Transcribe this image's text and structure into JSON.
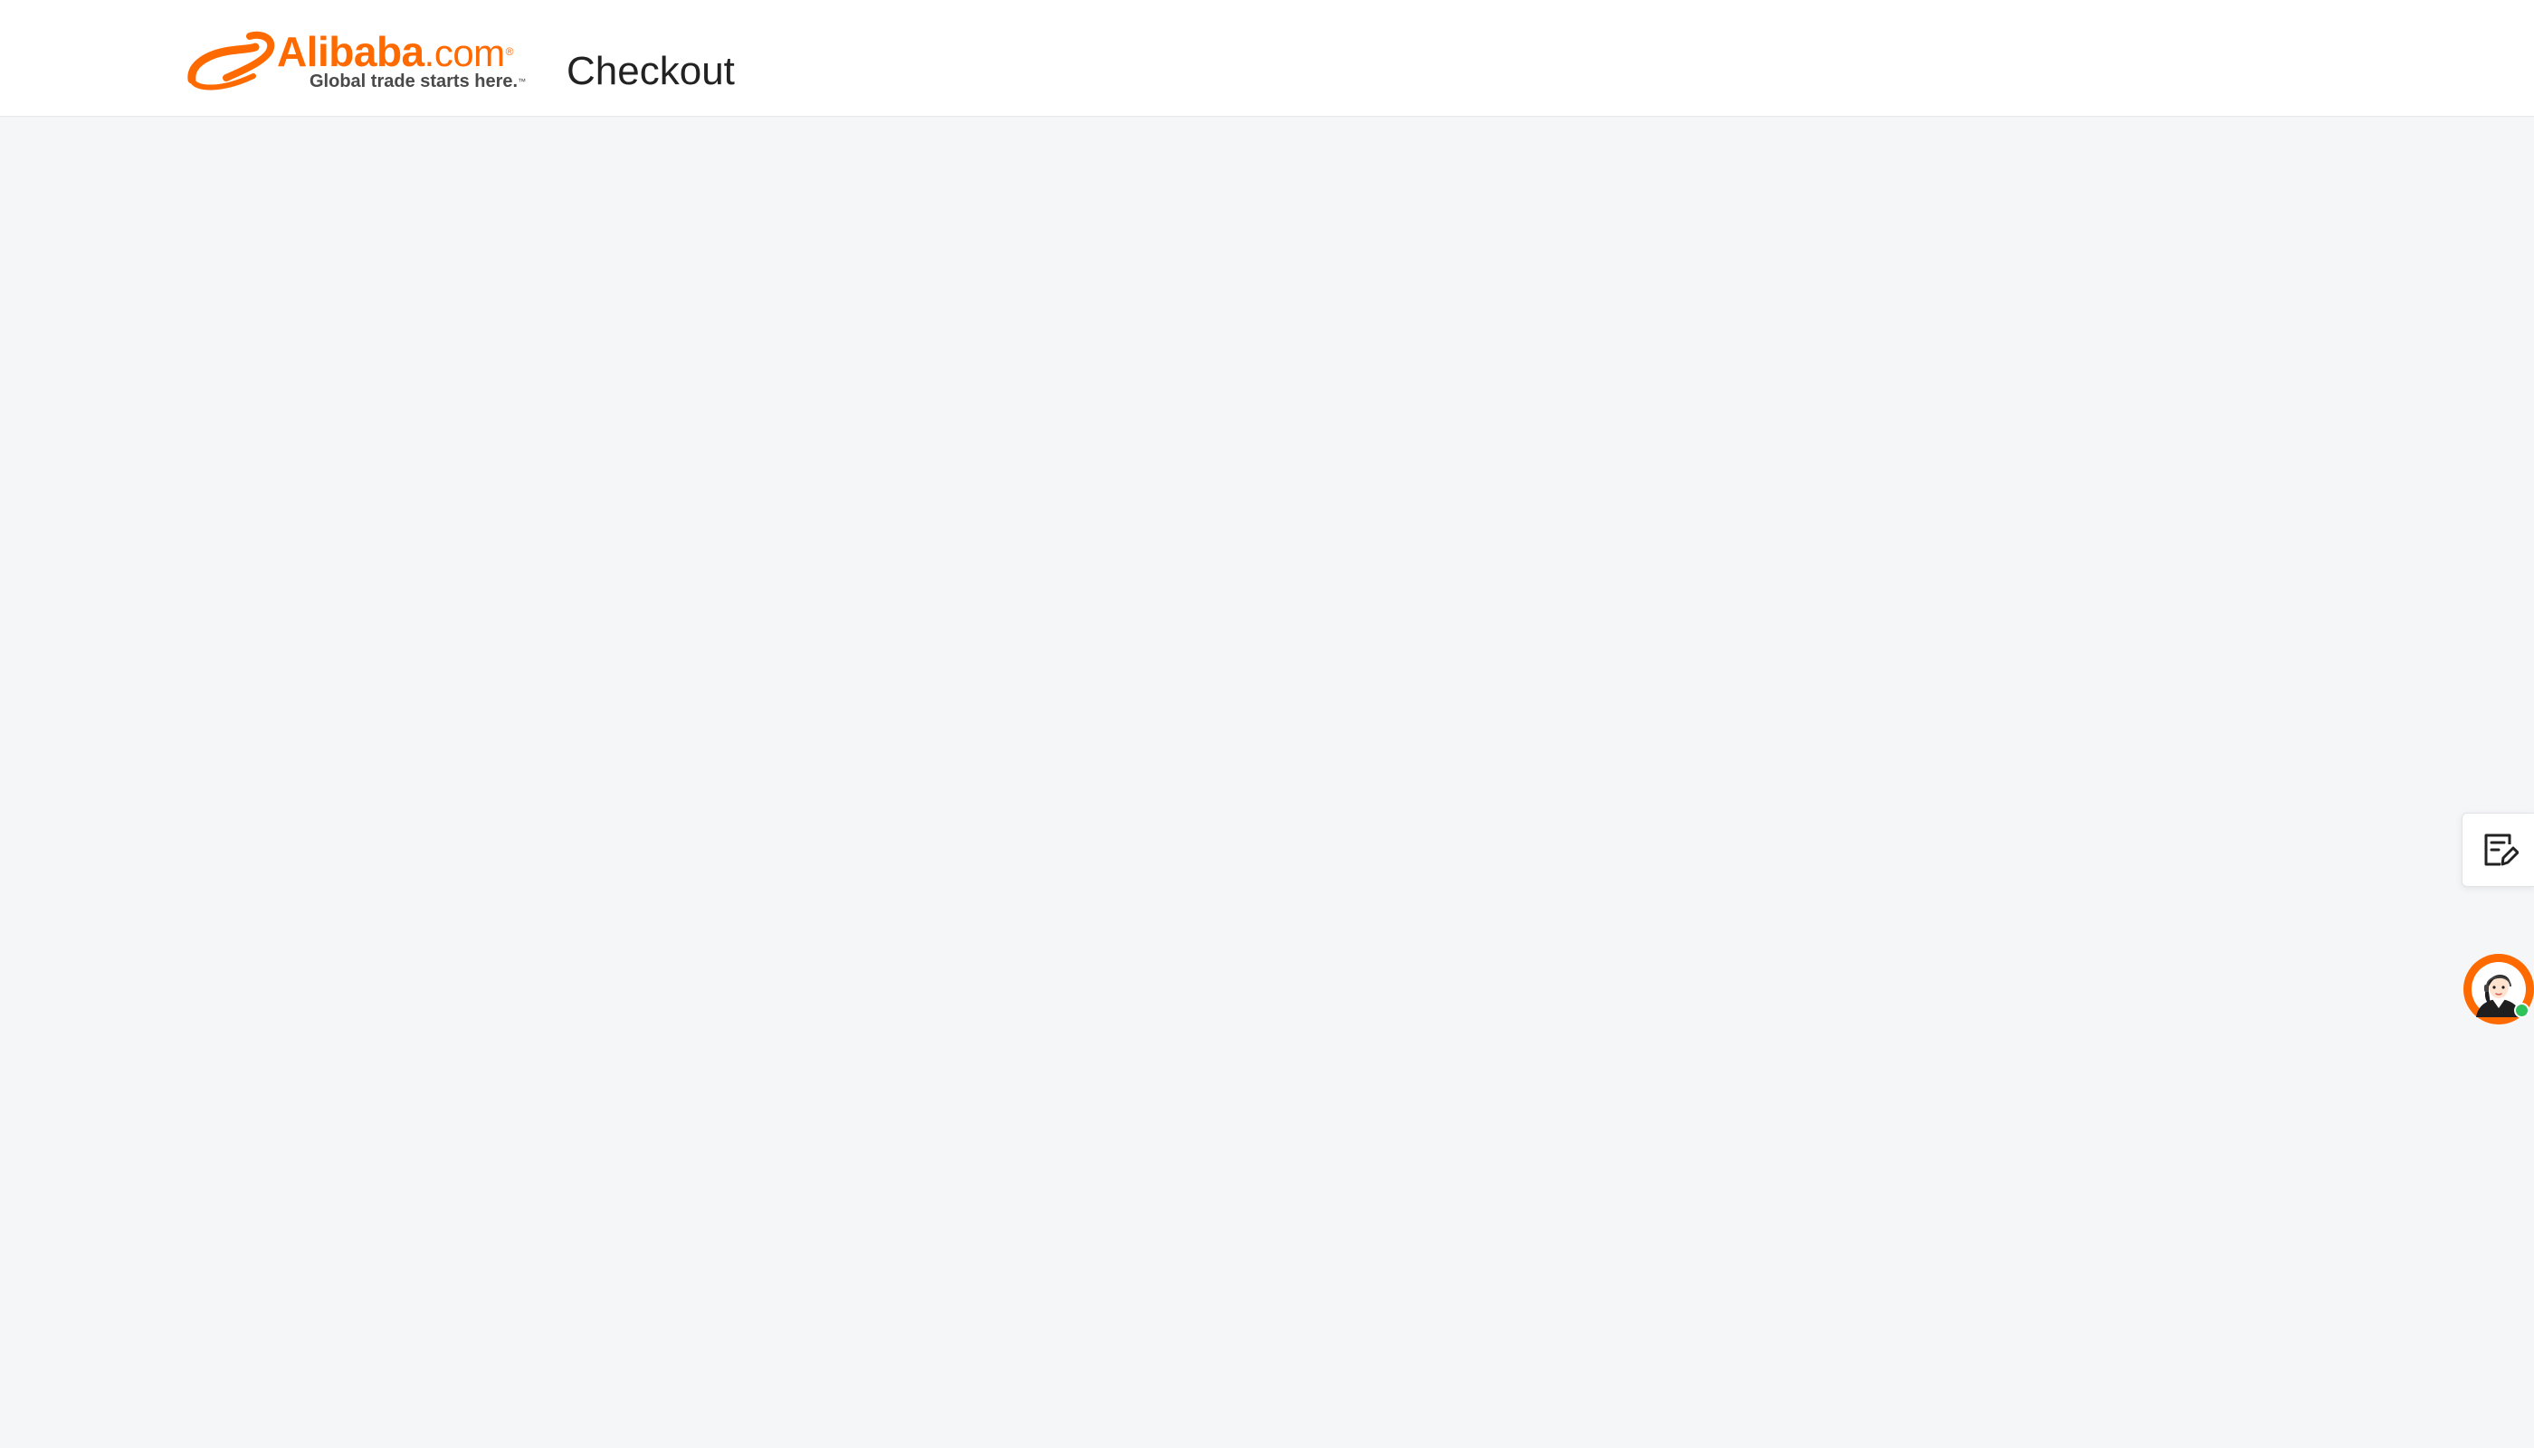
{
  "header": {
    "logo": {
      "wordmark": "Alibaba",
      "domain": ".com",
      "registered_mark": "®",
      "tagline": "Global trade starts here.",
      "trademark": "™",
      "icon": "alibaba-smile-icon"
    },
    "page_title": "Checkout"
  },
  "side_widgets": {
    "feedback": {
      "icon": "feedback-note-edit-icon"
    },
    "assistant": {
      "icon": "customer-service-avatar-icon",
      "status": "online"
    }
  },
  "colors": {
    "brand_orange": "#ff6a00",
    "page_background": "#f5f6f8",
    "header_background": "#ffffff",
    "online_green": "#2ec25b",
    "title_text": "#222222"
  }
}
